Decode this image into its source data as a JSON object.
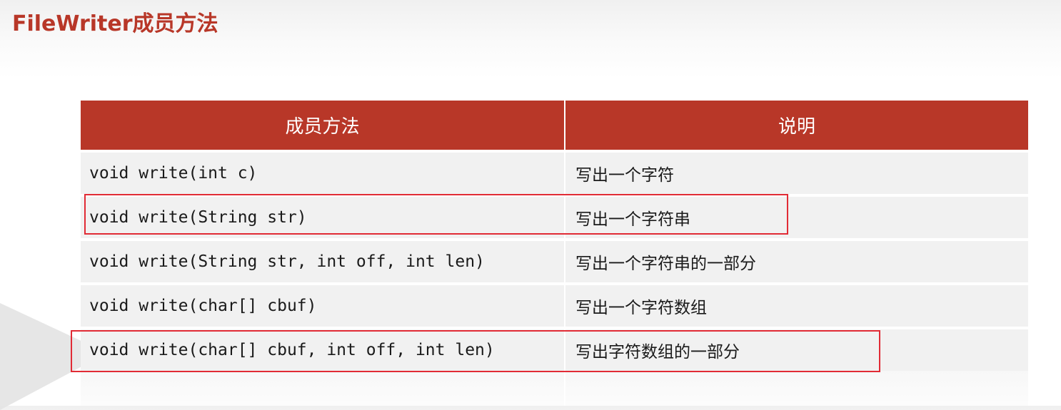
{
  "slide": {
    "title": "FileWriter成员方法"
  },
  "table": {
    "headers": {
      "method": "成员方法",
      "description": "说明"
    },
    "rows": [
      {
        "method": "void write(int c)",
        "description": "写出一个字符"
      },
      {
        "method": "void write(String str)",
        "description": "写出一个字符串"
      },
      {
        "method": "void write(String str, int off, int len)",
        "description": "写出一个字符串的一部分"
      },
      {
        "method": "void write(char[] cbuf)",
        "description": "写出一个字符数组"
      },
      {
        "method": "void write(char[] cbuf, int off, int len)",
        "description": "写出字符数组的一部分"
      }
    ]
  },
  "annotations": {
    "highlight_color": "#e12b35",
    "highlighted_rows": [
      2,
      5
    ]
  },
  "colors": {
    "accent": "#b83728",
    "row_background": "#f1f1f1",
    "text": "#1a1a1a"
  }
}
